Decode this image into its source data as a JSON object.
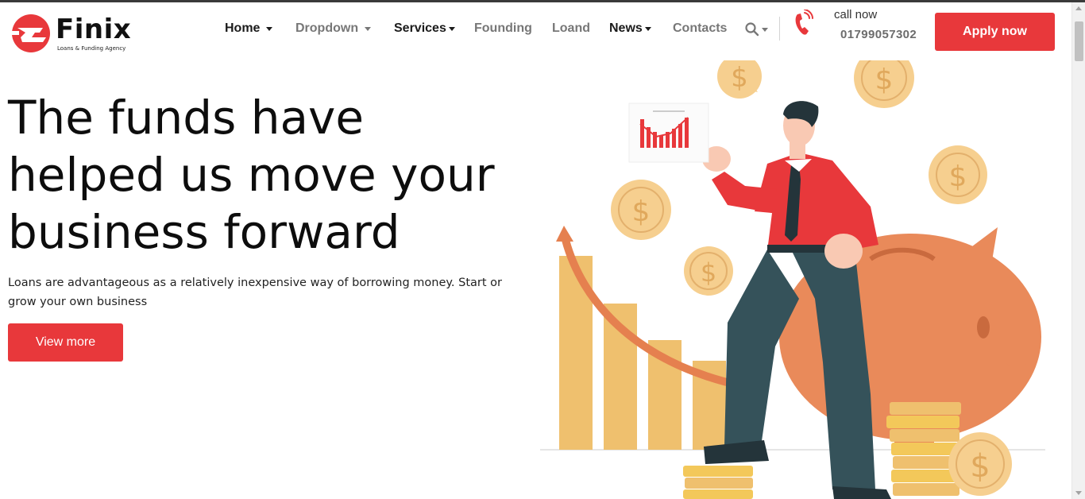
{
  "brand": {
    "name": "Finix",
    "tagline": "Loans & Funding Agency"
  },
  "nav": {
    "items": [
      {
        "label": "Home",
        "dropdown": true,
        "active": true
      },
      {
        "label": "Dropdown",
        "dropdown": true,
        "active": false
      },
      {
        "label": "Services",
        "dropdown": true,
        "active": true
      },
      {
        "label": "Founding",
        "dropdown": false,
        "active": false
      },
      {
        "label": "Loand",
        "dropdown": false,
        "active": false
      },
      {
        "label": "News",
        "dropdown": true,
        "active": true
      },
      {
        "label": "Contacts",
        "dropdown": false,
        "active": false
      }
    ],
    "search_icon": "search-icon"
  },
  "contact": {
    "label": "call now",
    "number": "01799057302",
    "icon": "phone-icon"
  },
  "cta": {
    "apply_label": "Apply now"
  },
  "hero": {
    "title": "The funds have helped us move your business forward",
    "subtitle": "Loans are advantageous as a relatively inexpensive way of borrowing money. Start or grow your own business",
    "button_label": "View more"
  },
  "colors": {
    "accent": "#e8383b",
    "nav_active": "#1b1b1b",
    "nav_muted": "#777777",
    "coin": "#f6cf8f",
    "bars": "#efc06e",
    "piggy": "#e98a5a",
    "pants": "#35525a",
    "shirt": "#e8383b"
  }
}
